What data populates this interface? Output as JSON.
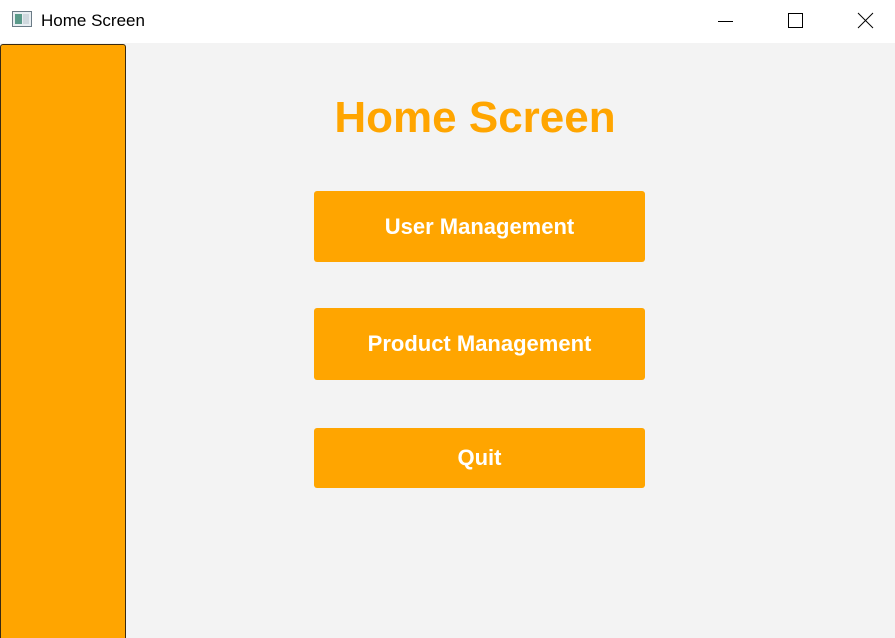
{
  "window": {
    "title": "Home Screen",
    "controls": [
      "minimize-icon",
      "maximize-icon",
      "close-icon"
    ]
  },
  "sidebar": {
    "color": "#FFA500"
  },
  "main": {
    "heading": "Home Screen",
    "buttons": [
      {
        "label": "User Management"
      },
      {
        "label": "Product Management"
      },
      {
        "label": "Quit"
      }
    ]
  },
  "colors": {
    "accent": "#FFA500",
    "background": "#F3F3F3",
    "button_text": "#FFFFFF"
  }
}
